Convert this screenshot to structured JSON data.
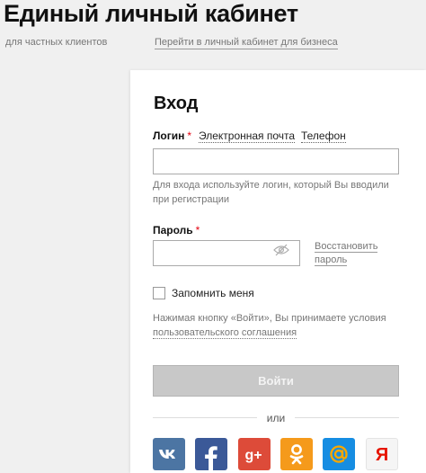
{
  "header": {
    "title": "Единый личный кабинет",
    "subtitle": "для частных клиентов",
    "business_link": "Перейти в личный кабинет для бизнеса"
  },
  "form": {
    "heading": "Вход",
    "login_label": "Логин",
    "required_mark": "*",
    "tabs": [
      {
        "label": "Электронная почта"
      },
      {
        "label": "Телефон"
      }
    ],
    "login_value": "",
    "login_hint": "Для входа используйте логин, который Вы вводили при регистрации",
    "password_label": "Пароль",
    "password_value": "",
    "restore_line1": "Восстановить",
    "restore_line2": "пароль",
    "remember_label": "Запомнить меня",
    "agree_prefix": "Нажимая кнопку «Войти», Вы принимаете условия",
    "agree_link": "пользовательского соглашения",
    "submit_label": "Войти",
    "or_label": "или"
  },
  "social": [
    {
      "name": "vk",
      "glyph": "vk",
      "color": "#4c75a3"
    },
    {
      "name": "facebook",
      "glyph": "f",
      "color": "#3b5998"
    },
    {
      "name": "google-plus",
      "glyph": "g+",
      "color": "#dd4b39"
    },
    {
      "name": "odnoklassniki",
      "glyph": "ok",
      "color": "#f59a1b"
    },
    {
      "name": "mail-ru",
      "glyph": "@",
      "color": "#168de2"
    },
    {
      "name": "yandex",
      "glyph": "Я",
      "color": "#e61400"
    }
  ]
}
